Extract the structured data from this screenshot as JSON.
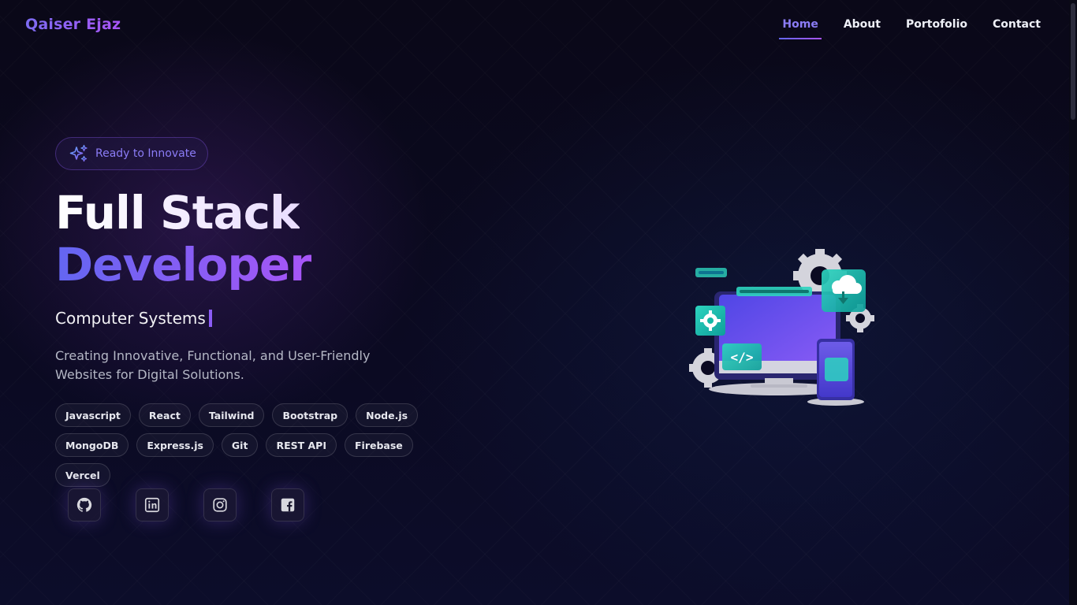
{
  "brand": "Qaiser Ejaz",
  "nav": {
    "items": [
      "Home",
      "About",
      "Portofolio",
      "Contact"
    ],
    "active": "Home"
  },
  "hero": {
    "badge_text": "Ready to Innovate",
    "title_line1": "Full Stack",
    "title_line2": "Developer",
    "typing_text": "Computer Systems",
    "description": "Creating Innovative, Functional, and User-Friendly Websites for Digital Solutions.",
    "tags": [
      "Javascript",
      "React",
      "Tailwind",
      "Bootstrap",
      "Node.js",
      "MongoDB",
      "Express.js",
      "Git",
      "REST API",
      "Firebase",
      "Vercel"
    ]
  },
  "socials": {
    "icons": [
      "github-icon",
      "linkedin-icon",
      "instagram-icon",
      "facebook-icon"
    ]
  },
  "colors": {
    "accent_start": "#6366f1",
    "accent_end": "#a855f7",
    "background": "#07061a"
  }
}
